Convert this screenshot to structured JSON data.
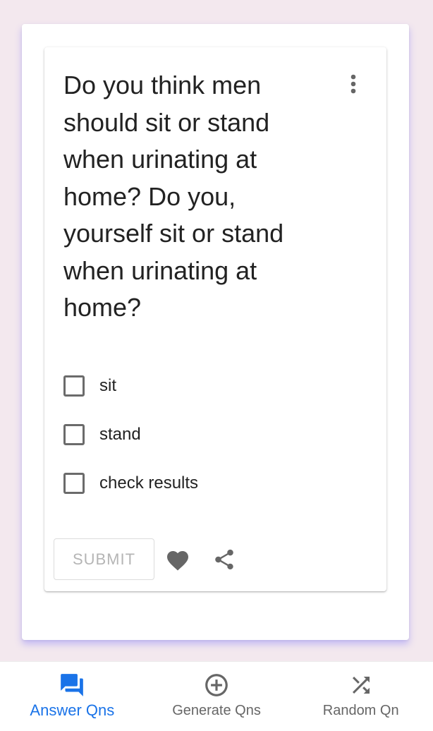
{
  "question": {
    "text": "Do you think men should sit or stand when urinating at home? Do you, yourself sit or stand when urinating at home?",
    "options": [
      {
        "label": "sit",
        "checked": false
      },
      {
        "label": "stand",
        "checked": false
      },
      {
        "label": "check results",
        "checked": false
      }
    ],
    "submit_label": "SUBMIT"
  },
  "icons": {
    "more": "more-vert-icon",
    "like": "heart-icon",
    "share": "share-icon"
  },
  "bottom_nav": {
    "items": [
      {
        "label": "Answer Qns",
        "icon": "forum-icon",
        "active": true
      },
      {
        "label": "Generate Qns",
        "icon": "add-circle-icon",
        "active": false
      },
      {
        "label": "Random Qn",
        "icon": "shuffle-icon",
        "active": false
      }
    ]
  },
  "colors": {
    "accent": "#1a73e8",
    "page_background": "#f3e8ee",
    "icon_gray": "#666666"
  }
}
